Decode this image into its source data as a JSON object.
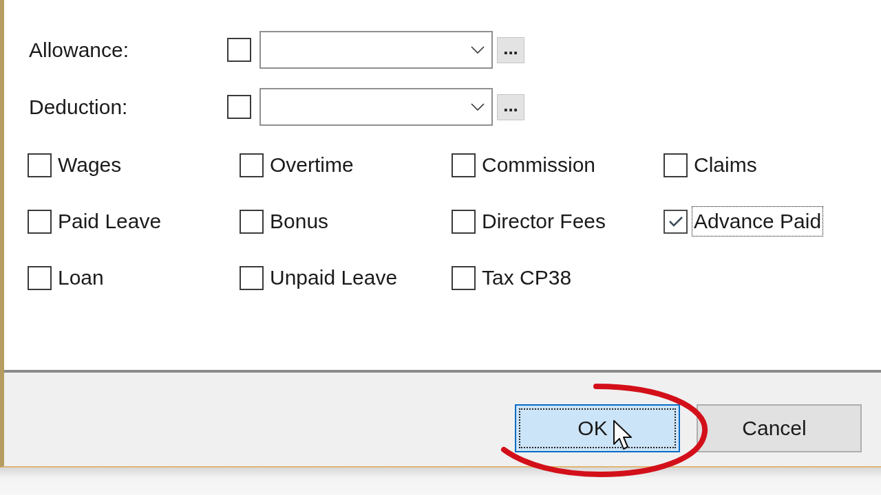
{
  "fields": [
    {
      "label": "Allowance:",
      "checked": false,
      "browse": "..."
    },
    {
      "label": "Deduction:",
      "checked": false,
      "browse": "..."
    }
  ],
  "options": [
    {
      "label": "Wages",
      "checked": false,
      "focused": false
    },
    {
      "label": "Overtime",
      "checked": false,
      "focused": false
    },
    {
      "label": "Commission",
      "checked": false,
      "focused": false
    },
    {
      "label": "Claims",
      "checked": false,
      "focused": false
    },
    {
      "label": "Paid Leave",
      "checked": false,
      "focused": false
    },
    {
      "label": "Bonus",
      "checked": false,
      "focused": false
    },
    {
      "label": "Director Fees",
      "checked": false,
      "focused": false
    },
    {
      "label": "Advance Paid",
      "checked": true,
      "focused": true
    },
    {
      "label": "Loan",
      "checked": false,
      "focused": false
    },
    {
      "label": "Unpaid Leave",
      "checked": false,
      "focused": false
    },
    {
      "label": "Tax CP38",
      "checked": false,
      "focused": false
    }
  ],
  "buttons": [
    {
      "label": "OK",
      "default": true,
      "focused": true
    },
    {
      "label": "Cancel",
      "default": false,
      "focused": false
    }
  ]
}
